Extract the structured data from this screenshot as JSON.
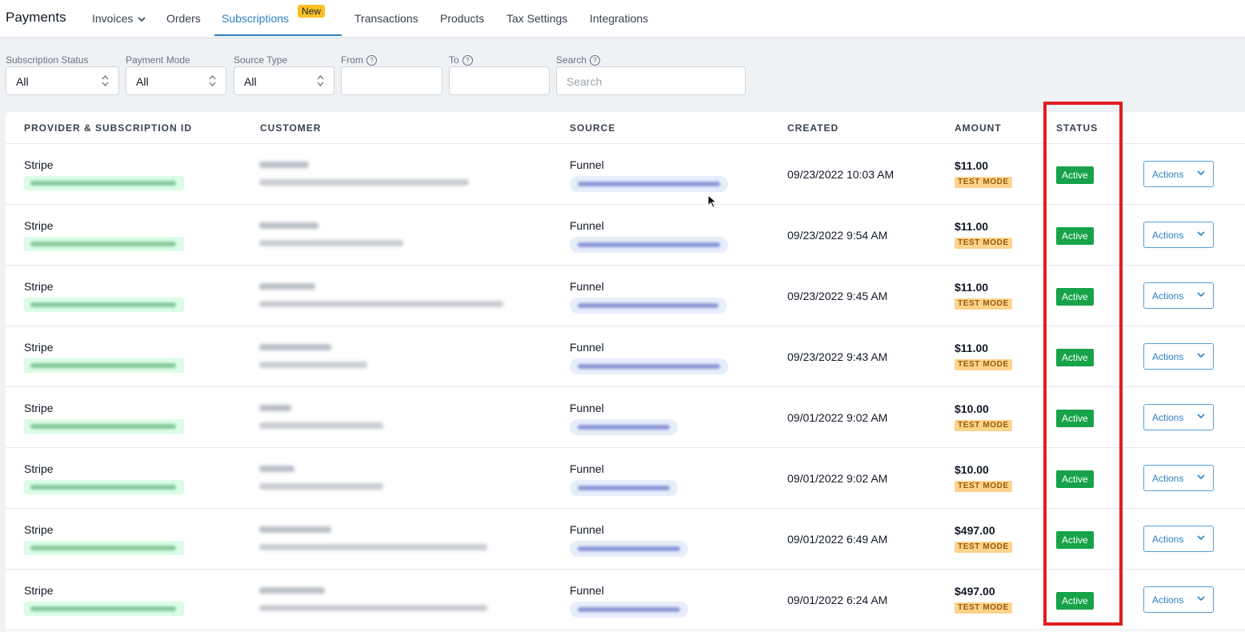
{
  "nav": {
    "brand": "Payments",
    "items": [
      {
        "label": "Invoices"
      },
      {
        "label": "Orders"
      },
      {
        "label": "Subscriptions",
        "badge": "New"
      },
      {
        "label": "Transactions"
      },
      {
        "label": "Products"
      },
      {
        "label": "Tax Settings"
      },
      {
        "label": "Integrations"
      }
    ]
  },
  "filters": {
    "subscription_status": {
      "label": "Subscription Status",
      "value": "All"
    },
    "payment_mode": {
      "label": "Payment Mode",
      "value": "All"
    },
    "source_type": {
      "label": "Source Type",
      "value": "All"
    },
    "from": {
      "label": "From"
    },
    "to": {
      "label": "To"
    },
    "search": {
      "label": "Search",
      "placeholder": "Search"
    }
  },
  "table": {
    "headers": [
      "PROVIDER & SUBSCRIPTION ID",
      "CUSTOMER",
      "SOURCE",
      "CREATED",
      "AMOUNT",
      "STATUS"
    ],
    "rows": [
      {
        "provider": "Stripe",
        "source": "Funnel",
        "created": "09/23/2022 10:03 AM",
        "amount": "$11.00",
        "mode": "TEST MODE",
        "status": "Active",
        "action": "Actions"
      },
      {
        "provider": "Stripe",
        "source": "Funnel",
        "created": "09/23/2022 9:54 AM",
        "amount": "$11.00",
        "mode": "TEST MODE",
        "status": "Active",
        "action": "Actions"
      },
      {
        "provider": "Stripe",
        "source": "Funnel",
        "created": "09/23/2022 9:45 AM",
        "amount": "$11.00",
        "mode": "TEST MODE",
        "status": "Active",
        "action": "Actions"
      },
      {
        "provider": "Stripe",
        "source": "Funnel",
        "created": "09/23/2022 9:43 AM",
        "amount": "$11.00",
        "mode": "TEST MODE",
        "status": "Active",
        "action": "Actions"
      },
      {
        "provider": "Stripe",
        "source": "Funnel",
        "created": "09/01/2022 9:02 AM",
        "amount": "$10.00",
        "mode": "TEST MODE",
        "status": "Active",
        "action": "Actions"
      },
      {
        "provider": "Stripe",
        "source": "Funnel",
        "created": "09/01/2022 9:02 AM",
        "amount": "$10.00",
        "mode": "TEST MODE",
        "status": "Active",
        "action": "Actions"
      },
      {
        "provider": "Stripe",
        "source": "Funnel",
        "created": "09/01/2022 6:49 AM",
        "amount": "$497.00",
        "mode": "TEST MODE",
        "status": "Active",
        "action": "Actions"
      },
      {
        "provider": "Stripe",
        "source": "Funnel",
        "created": "09/01/2022 6:24 AM",
        "amount": "$497.00",
        "mode": "TEST MODE",
        "status": "Active",
        "action": "Actions"
      }
    ]
  },
  "colors": {
    "accent": "#2f80c4",
    "status_active": "#16a34a",
    "test_mode_bg": "#fcd38d",
    "highlight_box": "#e11d1d"
  }
}
